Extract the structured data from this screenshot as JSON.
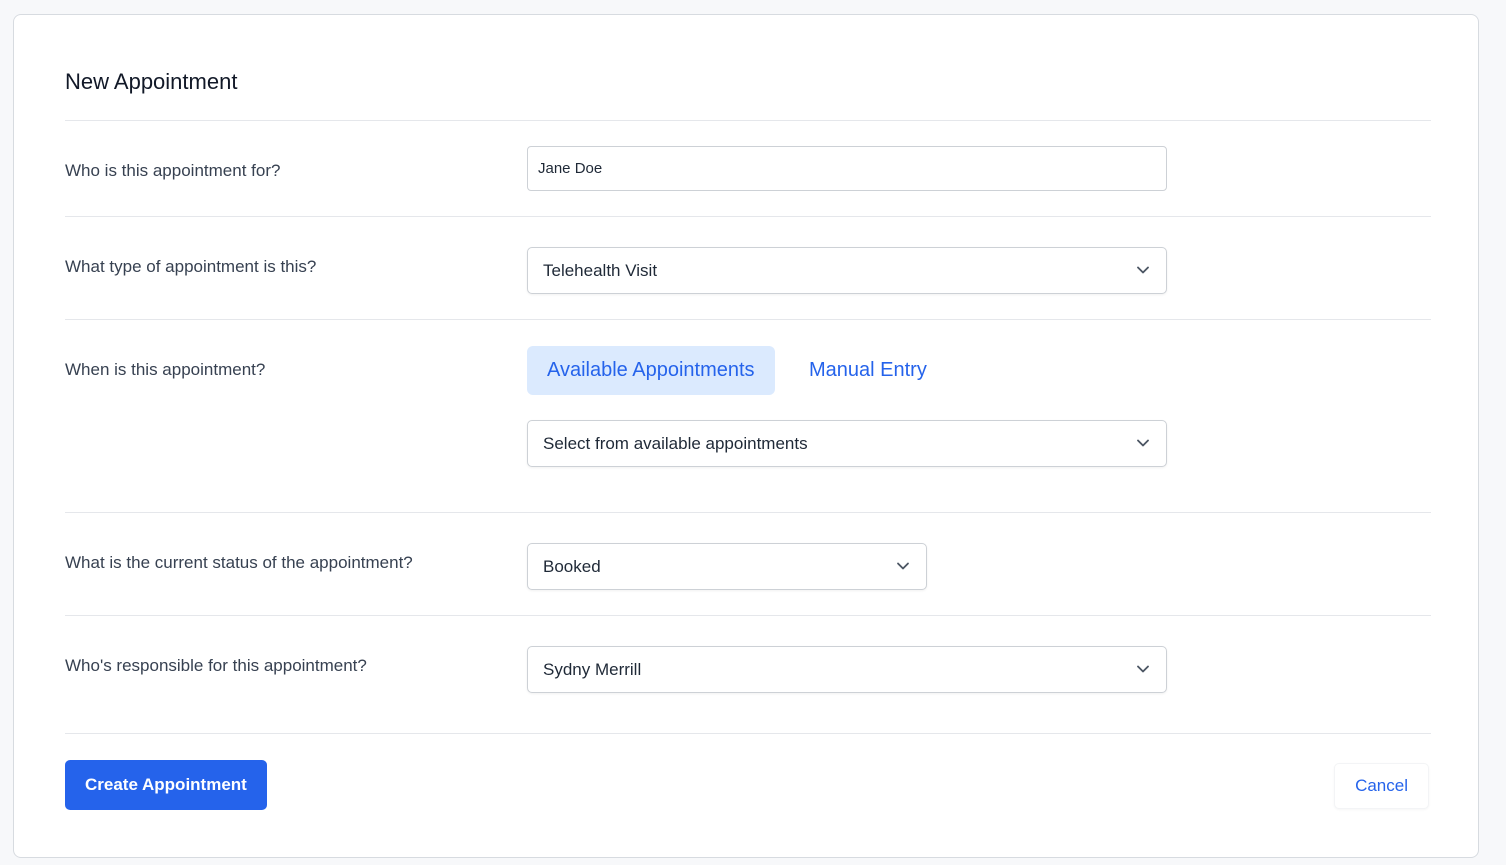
{
  "form": {
    "title": "New Appointment",
    "patient": {
      "label": "Who is this appointment for?",
      "value": "Jane Doe"
    },
    "type": {
      "label": "What type of appointment is this?",
      "selected": "Telehealth Visit"
    },
    "when": {
      "label": "When is this appointment?",
      "tabs": [
        {
          "label": "Available Appointments",
          "active": true
        },
        {
          "label": "Manual Entry",
          "active": false
        }
      ],
      "slot_placeholder": "Select from available appointments"
    },
    "status": {
      "label": "What is the current status of the appointment?",
      "selected": "Booked"
    },
    "responsible": {
      "label": "Who's responsible for this appointment?",
      "selected": "Sydny Merrill"
    },
    "actions": {
      "create_label": "Create Appointment",
      "cancel_label": "Cancel"
    }
  },
  "icons": {
    "dropdown": "chevron-down-icon"
  },
  "colors": {
    "accent": "#2563eb",
    "accent_light": "#dbeafe",
    "border": "#cdd1d6",
    "divider": "#e5e7eb"
  }
}
